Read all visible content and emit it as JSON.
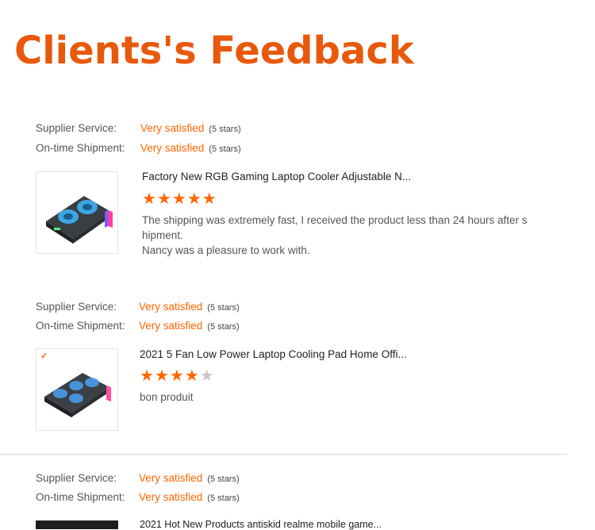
{
  "page": {
    "title": "Clients's Feedback"
  },
  "labels": {
    "supplier_service": "Supplier Service:",
    "on_time_shipment": "On-time Shipment:"
  },
  "colors": {
    "accent": "#ff6600",
    "title": "#e8590c",
    "star_off": "#c8c8c8"
  },
  "reviews": [
    {
      "supplier_service": "Very satisfied",
      "supplier_service_count": "(5 stars)",
      "on_time_shipment": "Very satisfied",
      "on_time_shipment_count": "(5 stars)",
      "product_title": "Factory New RGB Gaming Laptop Cooler Adjustable N...",
      "rating": 5,
      "comment_line1": "The shipping was extremely fast, I received the product less than 24 hours after s",
      "comment_line2": "hipment.",
      "comment_line3": "Nancy was a pleasure to work with."
    },
    {
      "supplier_service": "Very satisfied",
      "supplier_service_count": "(5 stars)",
      "on_time_shipment": "Very satisfied",
      "on_time_shipment_count": "(5 stars)",
      "product_title": "2021 5 Fan Low Power Laptop Cooling Pad Home Offi...",
      "rating": 4,
      "comment_line1": "bon produit"
    },
    {
      "supplier_service": "Very satisfied",
      "supplier_service_count": "(5 stars)",
      "on_time_shipment": "Very satisfied",
      "on_time_shipment_count": "(5 stars)",
      "product_title": "2021 Hot New Products antiskid realme mobile game..."
    }
  ]
}
